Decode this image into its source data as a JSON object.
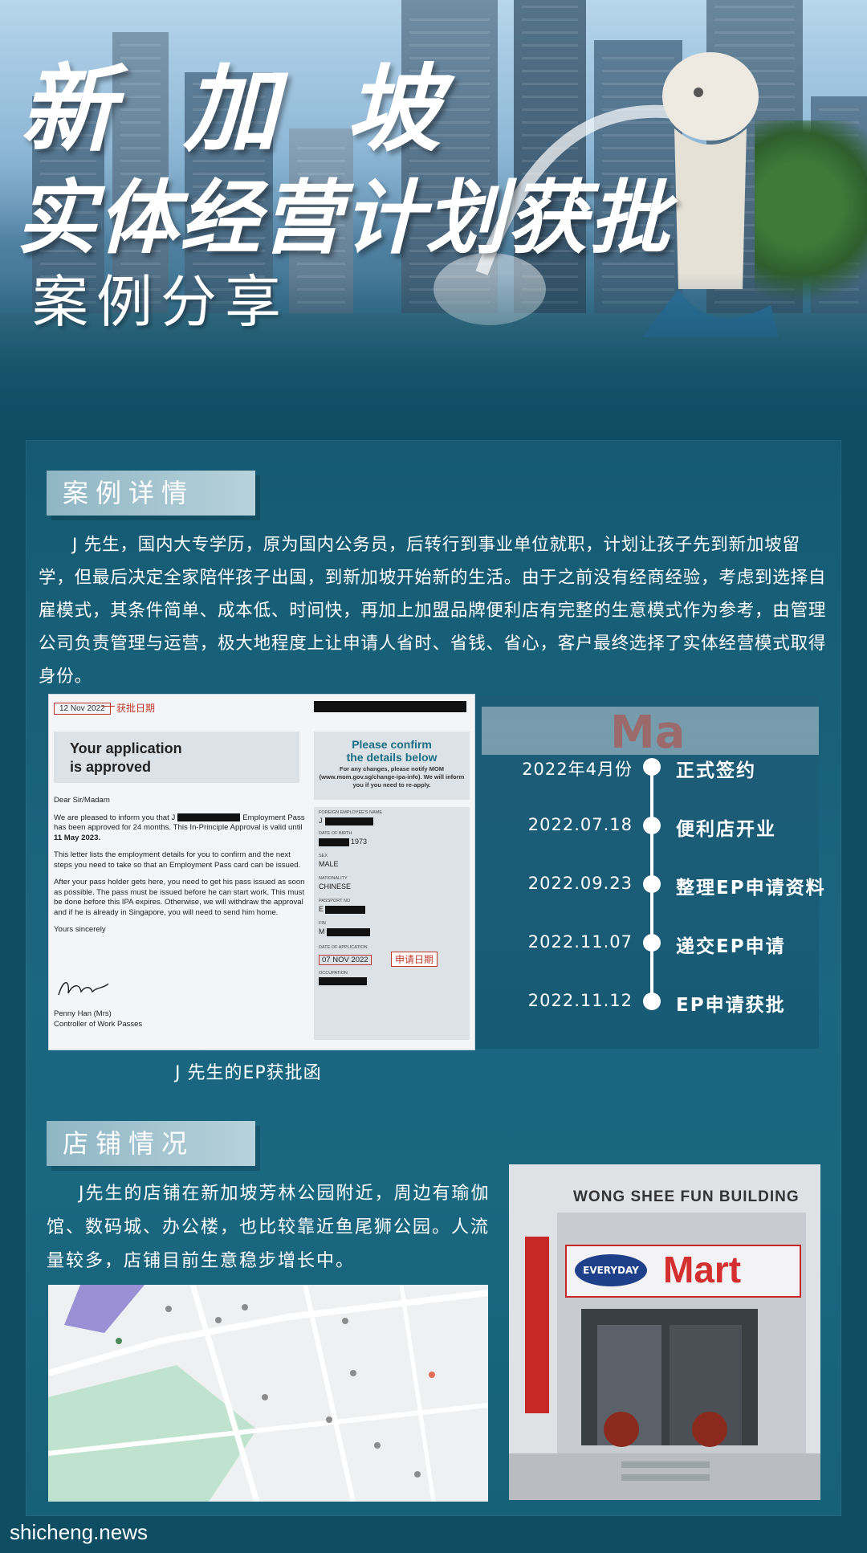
{
  "hero": {
    "title_line1": "新 加 坡",
    "title_line2": "实体经营计划获批",
    "title_line3": "案例分享"
  },
  "case_details": {
    "tag": "案例详情",
    "paragraph": "J 先生，国内大专学历，原为国内公务员，后转行到事业单位就职，计划让孩子先到新加坡留学，但最后决定全家陪伴孩子出国，到新加坡开始新的生活。由于之前没有经商经验，考虑到选择自雇模式，其条件简单、成本低、时间快，再加上加盟品牌便利店有完整的生意模式作为参考，由管理公司负责管理与运营，极大地程度上让申请人省时、省钱、省心，客户最终选择了实体经营模式取得身份。"
  },
  "letter": {
    "date": "12 Nov 2022",
    "date_note": "获批日期",
    "approved_title_1": "Your application",
    "approved_title_2": "is approved",
    "confirm_title_1": "Please confirm",
    "confirm_title_2": "the details below",
    "confirm_sub": "For any changes, please notify MOM (www.mom.gov.sg/change-ipa-info). We will inform you if you need to re-apply.",
    "salutation": "Dear Sir/Madam",
    "body_1a": "We are pleased to inform you that J",
    "body_1b": "Employment Pass has been approved for 24 months. This In-Principle Approval is valid until",
    "body_1c": "11 May 2023.",
    "body_2": "This letter lists the employment details for you to confirm and the next steps you need to take so that an Employment Pass card can be issued.",
    "body_3": "After your pass holder gets here, you need to get his pass issued as soon as possible. The pass must be issued before he can start work. This must be done before this IPA expires. Otherwise, we will withdraw the approval and if he is already in Singapore, you will need to send him home.",
    "closing": "Yours sincerely",
    "signer_name": "Penny Han (Mrs)",
    "signer_title": "Controller of Work Passes",
    "fields": {
      "name_label": "FOREIGN EMPLOYEE'S NAME",
      "name_value": "J",
      "dob_label": "DATE OF BIRTH",
      "dob_value": "1973",
      "sex_label": "SEX",
      "sex_value": "MALE",
      "nationality_label": "NATIONALITY",
      "nationality_value": "CHINESE",
      "passport_label": "PASSPORT NO",
      "passport_value": "E",
      "fin_label": "FIN",
      "fin_value": "M",
      "application_label": "DATE OF APPLICATION",
      "application_value": "07 NOV 2022",
      "application_note": "申请日期",
      "occupation_label": "OCCUPATION"
    },
    "caption": "J 先生的EP获批函"
  },
  "timeline": [
    {
      "date": "2022年4月份",
      "event": "正式签约"
    },
    {
      "date": "2022.07.18",
      "event": "便利店开业"
    },
    {
      "date": "2022.09.23",
      "event": "整理EP申请资料"
    },
    {
      "date": "2022.11.07",
      "event": "递交EP申请"
    },
    {
      "date": "2022.11.12",
      "event": "EP申请获批"
    }
  ],
  "store_sign_text": "Ma",
  "store": {
    "tag": "店铺情况",
    "paragraph": "J先生的店铺在新加坡芳林公园附近，周边有瑜伽馆、数码城、办公楼，也比较靠近鱼尾狮公园。人流量较多，店铺目前生意稳步增长中。"
  },
  "photo": {
    "building_name": "WONG SHEE FUN BUILDING",
    "sign_brand": "EVERYDAY",
    "sign_mart": "Mart"
  },
  "watermark": "shicheng.news",
  "colors": {
    "panel": "#1b6580",
    "tag": "#a7c6d1",
    "accent_red": "#c0392b"
  }
}
